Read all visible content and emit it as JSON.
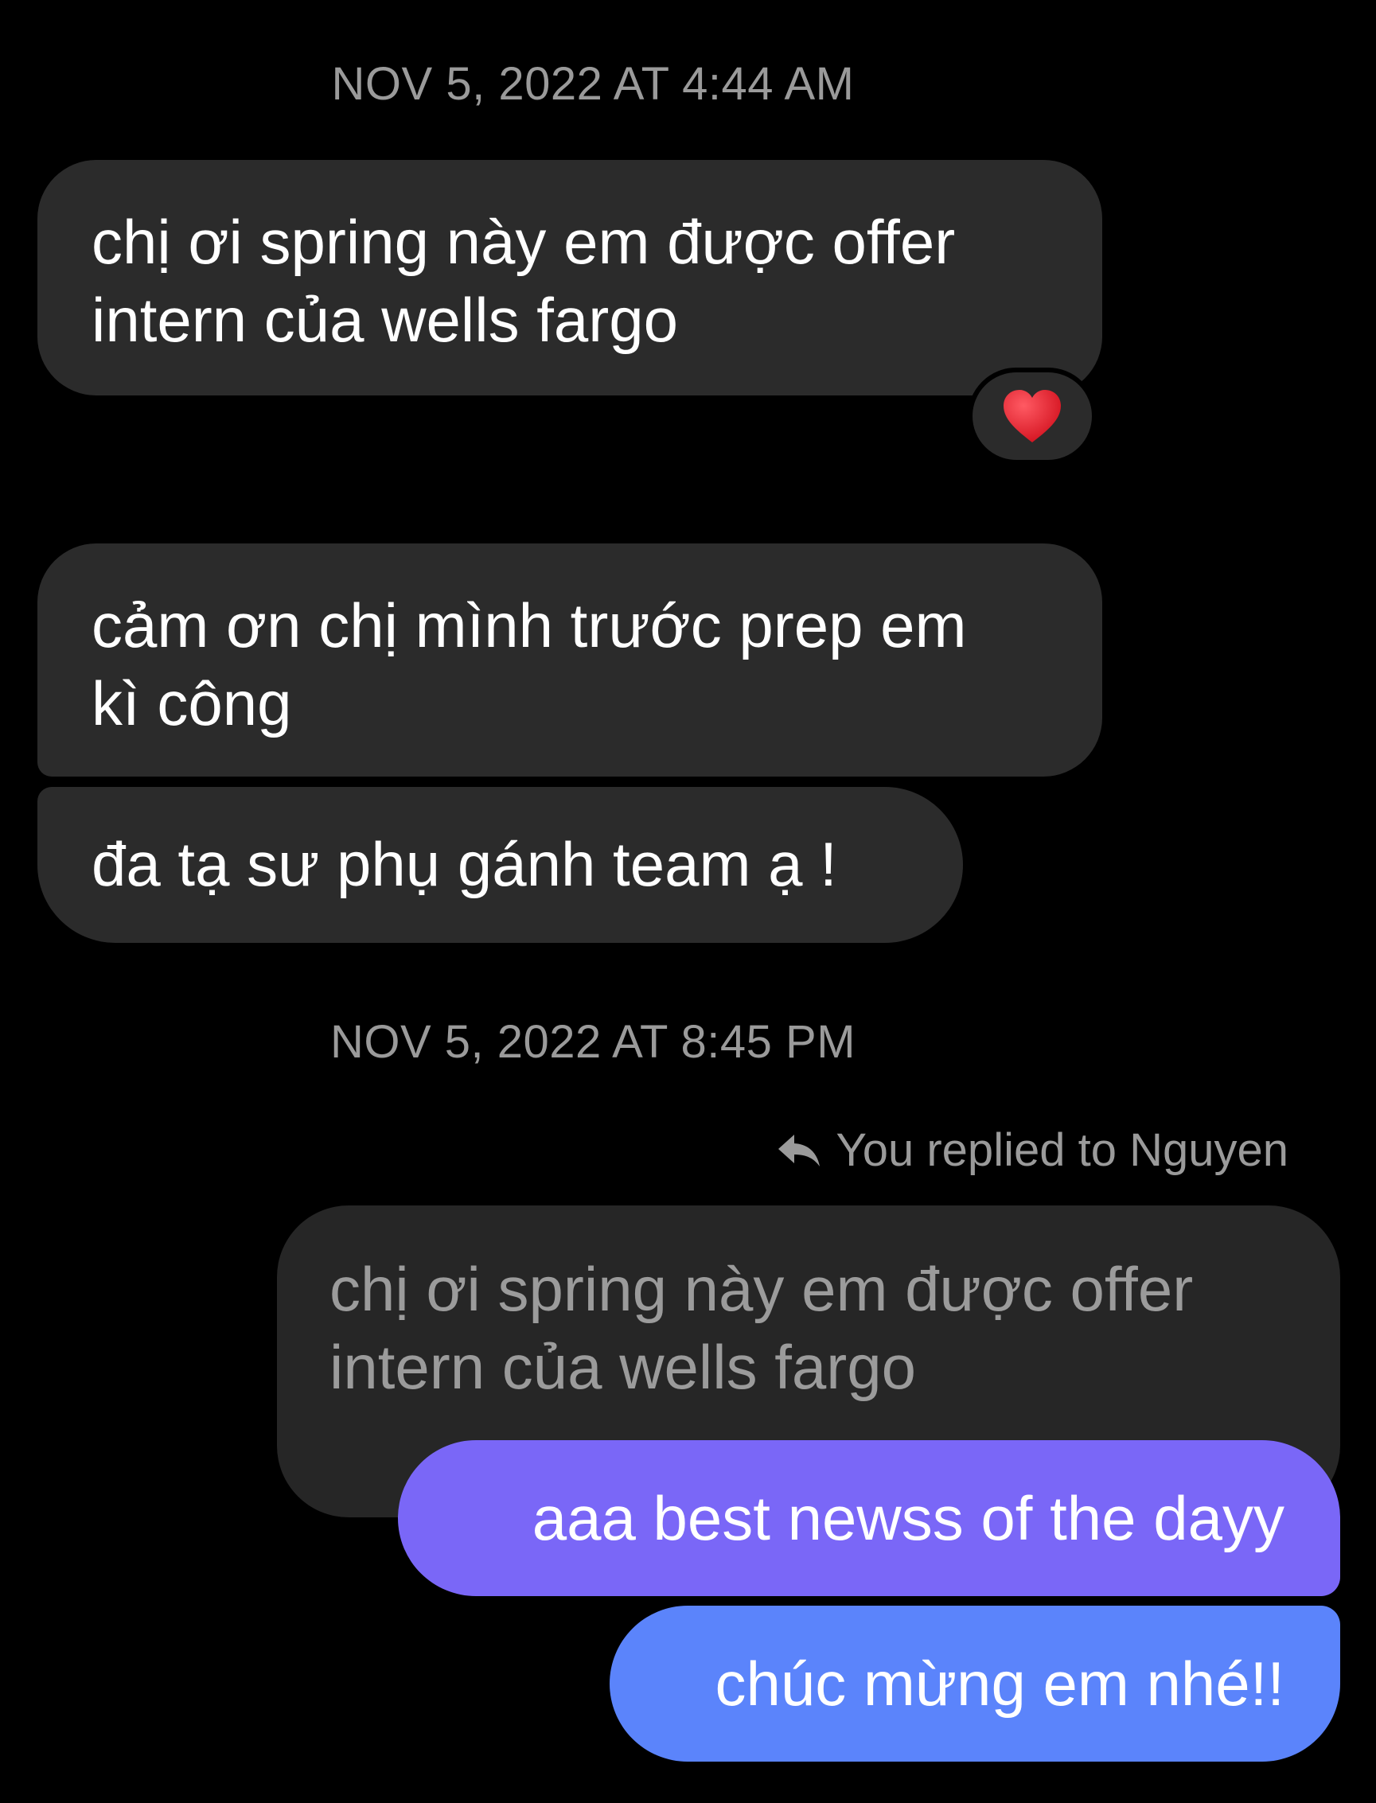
{
  "thread": {
    "timestamp_1": "NOV 5, 2022 AT 4:44 AM",
    "timestamp_2": "NOV 5, 2022 AT 8:45 PM",
    "incoming_messages": [
      {
        "line1": "chị ơi spring này em được offer",
        "line2": "intern của wells fargo"
      },
      {
        "line1": "cảm ơn chị mình trước prep em",
        "line2": "kì công"
      },
      {
        "line1": "đa tạ sư phụ gánh team ạ !"
      }
    ],
    "reaction": {
      "icon": "heart-icon",
      "color": "#e8232f"
    },
    "reply": {
      "label": "You replied to Nguyen",
      "quoted_line1": "chị ơi spring này em được offer",
      "quoted_line2": "intern của wells fargo"
    },
    "outgoing_messages": [
      {
        "text": "aaa best newss of the dayy",
        "color": "#7a67f7"
      },
      {
        "text": "chúc mừng em nhé!!",
        "color": "#5b84fb"
      }
    ]
  }
}
